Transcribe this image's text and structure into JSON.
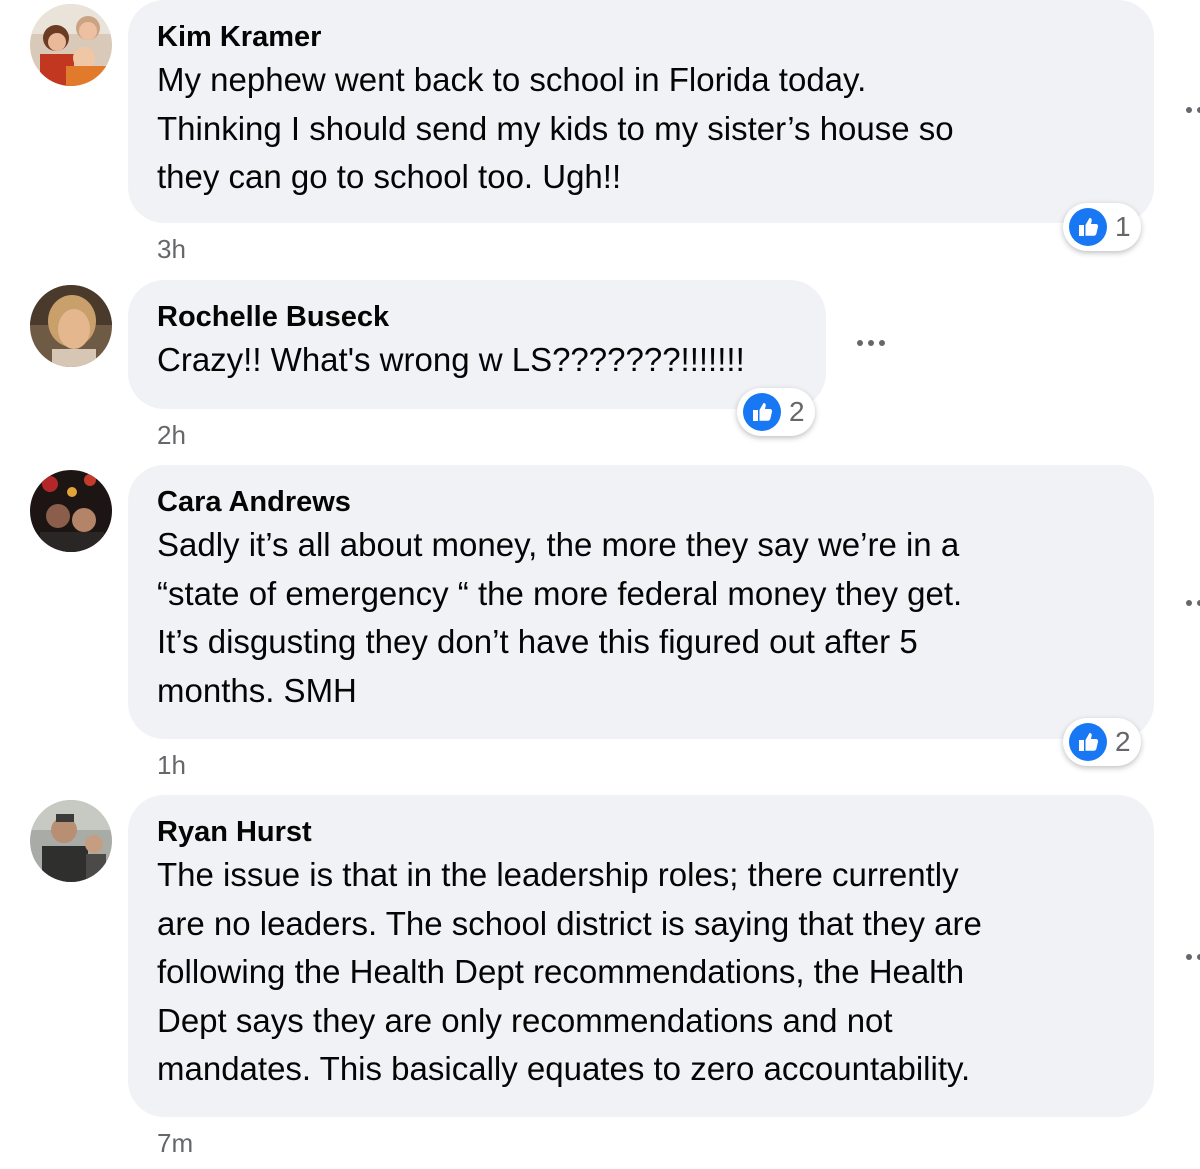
{
  "comments": [
    {
      "author": "Kim Kramer",
      "lines": [
        "My nephew went back to school in Florida today.",
        "Thinking I should send my kids to my sister’s house so",
        "they can go to school too. Ugh!!"
      ],
      "time": "3h",
      "reaction_count": "1",
      "avatar_icon": "avatar-photo-family"
    },
    {
      "author": "Rochelle Buseck",
      "lines": [
        "Crazy!! What's wrong w LS???????!!!!!!!"
      ],
      "time": "2h",
      "reaction_count": "2",
      "avatar_icon": "avatar-photo-woman"
    },
    {
      "author": "Cara Andrews",
      "lines": [
        "Sadly it’s all about money, the more they say we’re in a",
        "“state of emergency “ the more federal money they get.",
        "It’s disgusting they don’t have this figured out after 5",
        "months. SMH"
      ],
      "time": "1h",
      "reaction_count": "2",
      "avatar_icon": "avatar-photo-night"
    },
    {
      "author": "Ryan Hurst",
      "lines": [
        "The issue is that in the leadership roles; there currently",
        "are no leaders. The school district is saying that they are",
        "following the Health Dept recommendations, the Health",
        "Dept says they are only recommendations and not",
        "mandates. This basically equates to zero accountability."
      ],
      "time": "7m",
      "avatar_icon": "avatar-photo-man"
    }
  ],
  "colors": {
    "bubble": "#f0f2f5",
    "like_blue": "#1877f2",
    "meta_gray": "#65676b"
  }
}
